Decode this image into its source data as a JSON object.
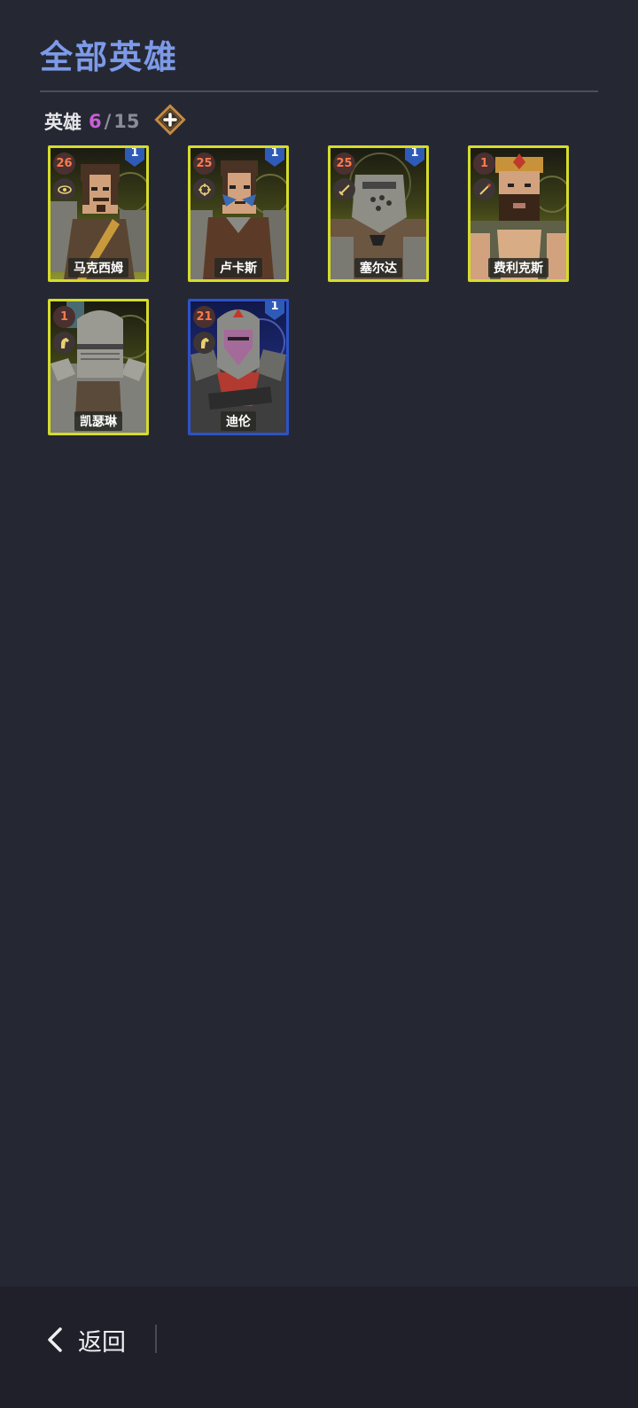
{
  "header": {
    "title": "全部英雄"
  },
  "hero_count": {
    "label": "英雄",
    "current": "6",
    "separator": "/",
    "max": "15"
  },
  "colors": {
    "title": "#7d9ae8",
    "count_current": "#c85fd6",
    "legendary_border": "#d6dc2a",
    "rare_border": "#2d52c8"
  },
  "heroes": [
    {
      "name": "马克西姆",
      "level": "26",
      "rank": "1",
      "class_icon": "eye-icon",
      "rarity": "gold"
    },
    {
      "name": "卢卡斯",
      "level": "25",
      "rank": "1",
      "class_icon": "crosshair-icon",
      "rarity": "gold"
    },
    {
      "name": "塞尔达",
      "level": "25",
      "rank": "1",
      "class_icon": "sword-icon",
      "rarity": "gold"
    },
    {
      "name": "费利克斯",
      "level": "1",
      "rank": "",
      "class_icon": "staff-icon",
      "rarity": "gold"
    },
    {
      "name": "凯瑟琳",
      "level": "1",
      "rank": "",
      "class_icon": "horse-icon",
      "rarity": "gold"
    },
    {
      "name": "迪伦",
      "level": "21",
      "rank": "1",
      "class_icon": "horse-icon",
      "rarity": "blue"
    }
  ],
  "footer": {
    "back_label": "返回"
  }
}
